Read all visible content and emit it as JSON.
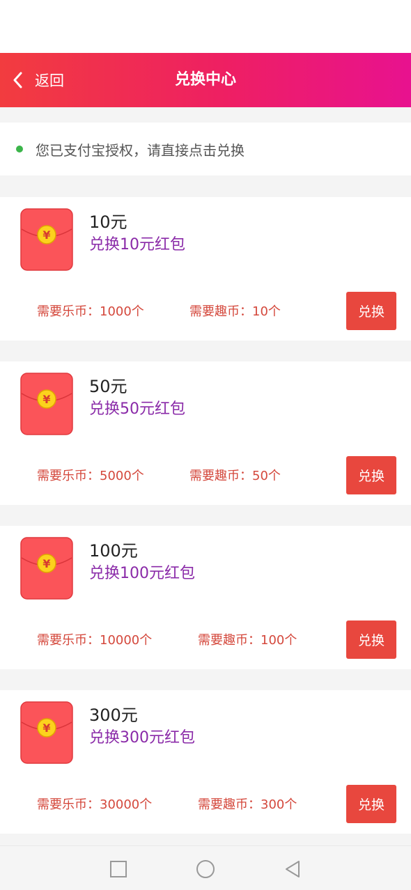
{
  "header": {
    "back_label": "返回",
    "title": "兑换中心",
    "gradient_colors": [
      "#f23c3f",
      "#e8128f"
    ]
  },
  "notice": {
    "text": "您已支付宝授权，请直接点击兑换",
    "dot_color": "#3bb54a"
  },
  "cards": [
    {
      "amount": "10元",
      "subtitle": "兑换10元红包",
      "lebi": "需要乐币：1000个",
      "qubi": "需要趣币：10个",
      "button": "兑换"
    },
    {
      "amount": "50元",
      "subtitle": "兑换50元红包",
      "lebi": "需要乐币：5000个",
      "qubi": "需要趣币：50个",
      "button": "兑换"
    },
    {
      "amount": "100元",
      "subtitle": "兑换100元红包",
      "lebi": "需要乐币：10000个",
      "qubi": "需要趣币：100个",
      "button": "兑换"
    },
    {
      "amount": "300元",
      "subtitle": "兑换300元红包",
      "lebi": "需要乐币：30000个",
      "qubi": "需要趣币：300个",
      "button": "兑换"
    }
  ],
  "envelope": {
    "coin_symbol": "¥",
    "body_color": "#fb5459",
    "coin_color": "#fcd21d"
  },
  "nav": {
    "icons": [
      "square-icon",
      "circle-icon",
      "triangle-back-icon"
    ]
  }
}
